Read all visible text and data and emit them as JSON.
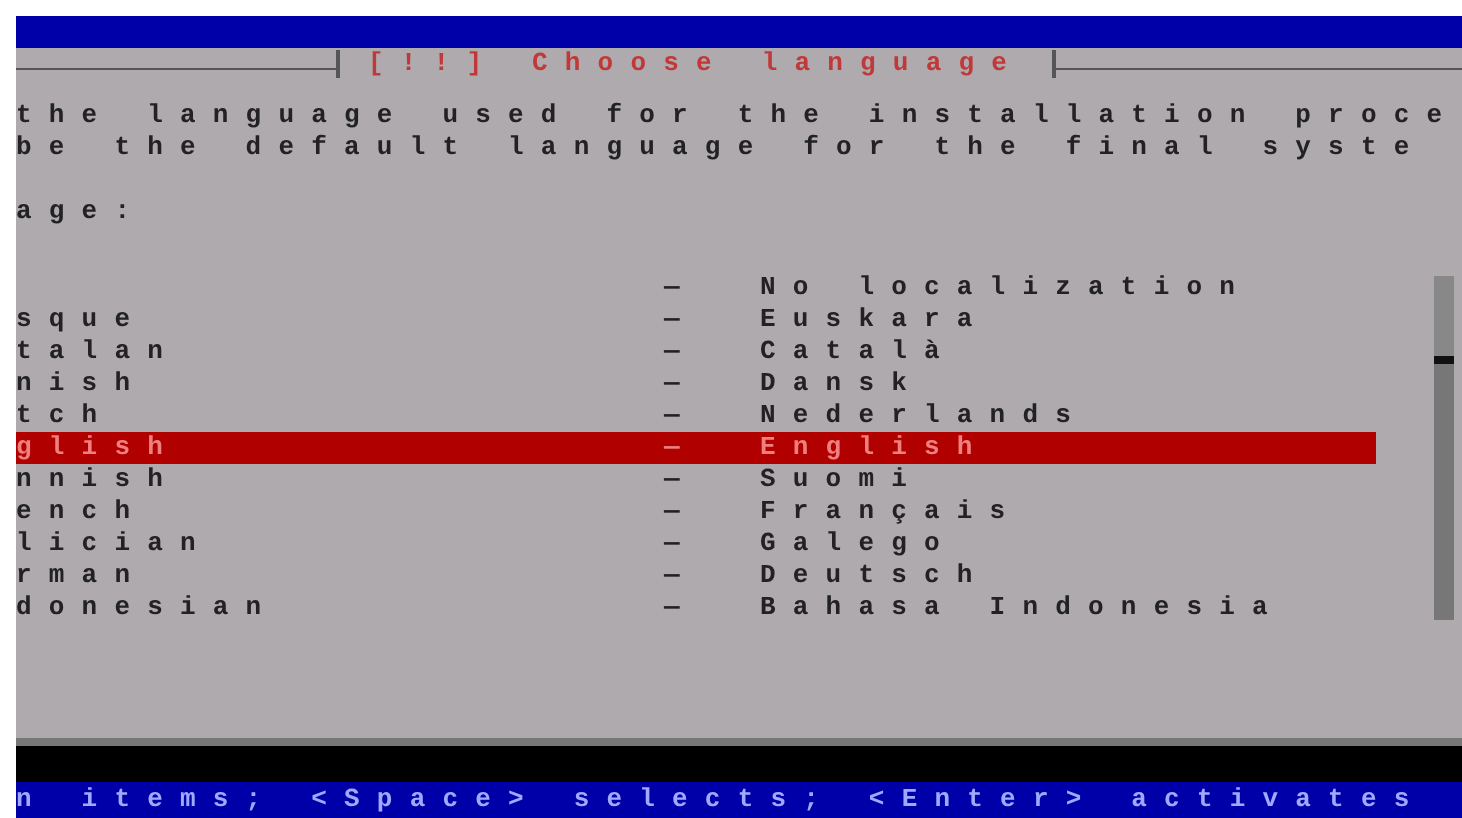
{
  "dialog": {
    "title": "[!!] Choose language",
    "description": [
      "the language used for the installation proce",
      "be the default language for the final syste"
    ],
    "list_label": "age:",
    "languages": [
      {
        "separator": "—",
        "native": "No localization",
        "selected": false
      },
      {
        "name": "sque",
        "separator": "—",
        "native": "Euskara",
        "selected": false
      },
      {
        "name": "talan",
        "separator": "—",
        "native": "Català",
        "selected": false
      },
      {
        "name": "nish",
        "separator": "—",
        "native": "Dansk",
        "selected": false
      },
      {
        "name": "tch",
        "separator": "—",
        "native": "Nederlands",
        "selected": false
      },
      {
        "name": "glish",
        "separator": "—",
        "native": "English",
        "selected": true
      },
      {
        "name": "nnish",
        "separator": "—",
        "native": "Suomi",
        "selected": false
      },
      {
        "name": "ench",
        "separator": "—",
        "native": "Français",
        "selected": false
      },
      {
        "name": "lician",
        "separator": "—",
        "native": "Galego",
        "selected": false
      },
      {
        "name": "rman",
        "separator": "—",
        "native": "Deutsch",
        "selected": false
      },
      {
        "name": "donesian",
        "separator": "—",
        "native": "Bahasa Indonesia",
        "selected": false
      }
    ]
  },
  "status_bar": "n items; <Space> selects; <Enter> activates"
}
